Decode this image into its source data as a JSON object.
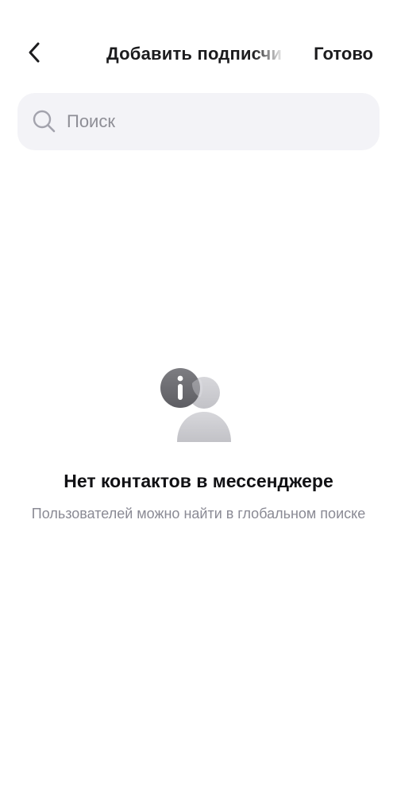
{
  "header": {
    "back_icon": "chevron-left-icon",
    "title": "Добавить подписчи",
    "done_label": "Готово"
  },
  "search": {
    "icon": "search-icon",
    "placeholder": "Поиск",
    "value": ""
  },
  "empty_state": {
    "icon": "contact-info-icon",
    "title": "Нет контактов в мессенджере",
    "subtitle": "Пользователей можно найти в глобальном поиске"
  },
  "colors": {
    "background": "#ffffff",
    "search_background": "#f3f3f7",
    "text_primary": "#1c1c1e",
    "text_secondary": "#8a8a94"
  }
}
